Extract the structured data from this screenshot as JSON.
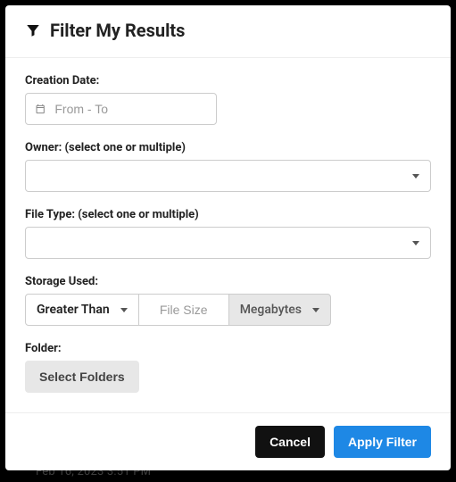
{
  "backdrop": {
    "ghost_text": "Feb 16, 2023 3:51 PM"
  },
  "modal": {
    "title": "Filter My Results",
    "creation_date": {
      "label": "Creation Date:",
      "placeholder": "From - To",
      "value": ""
    },
    "owner": {
      "label": "Owner: (select one or multiple)",
      "selected": ""
    },
    "file_type": {
      "label": "File Type: (select one or multiple)",
      "selected": ""
    },
    "storage": {
      "label": "Storage Used:",
      "comparison": "Greater Than",
      "size_placeholder": "File Size",
      "size_value": "",
      "unit": "Megabytes"
    },
    "folder": {
      "label": "Folder:",
      "button": "Select Folders"
    },
    "footer": {
      "cancel": "Cancel",
      "apply": "Apply Filter"
    }
  }
}
